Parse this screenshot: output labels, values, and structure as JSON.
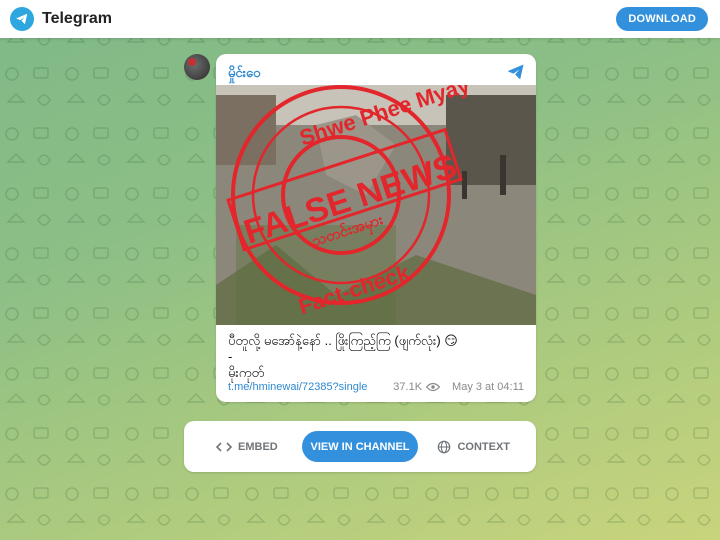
{
  "header": {
    "brand": "Telegram",
    "download_label": "DOWNLOAD"
  },
  "post": {
    "channel": "မှိုင်းဝေ",
    "stamp": {
      "top_text": "Shwe Phee Myay",
      "main_text": "FALSE NEWS",
      "sub_text": "သတင်းအမှား",
      "bottom_text": "Fact-check"
    },
    "caption_lines": [
      "ပီတူလို့ မအော်နဲ့နော် .. ဖြိုးကြည့်ကြ (ဖျက်လုံး) 😏",
      "-",
      "မိုးကုတ်"
    ],
    "link": "t.me/hminewai/72385?single",
    "views": "37.1K",
    "date": "May 3 at 04:11"
  },
  "actions": {
    "embed": "EMBED",
    "view_in_channel": "VIEW IN CHANNEL",
    "context": "CONTEXT"
  },
  "colors": {
    "accent": "#3390dc",
    "link": "#2f8ad0",
    "stamp": "#e2262b"
  },
  "icons": [
    "telegram-logo-icon",
    "share-icon",
    "eye-icon",
    "code-icon",
    "globe-icon"
  ]
}
